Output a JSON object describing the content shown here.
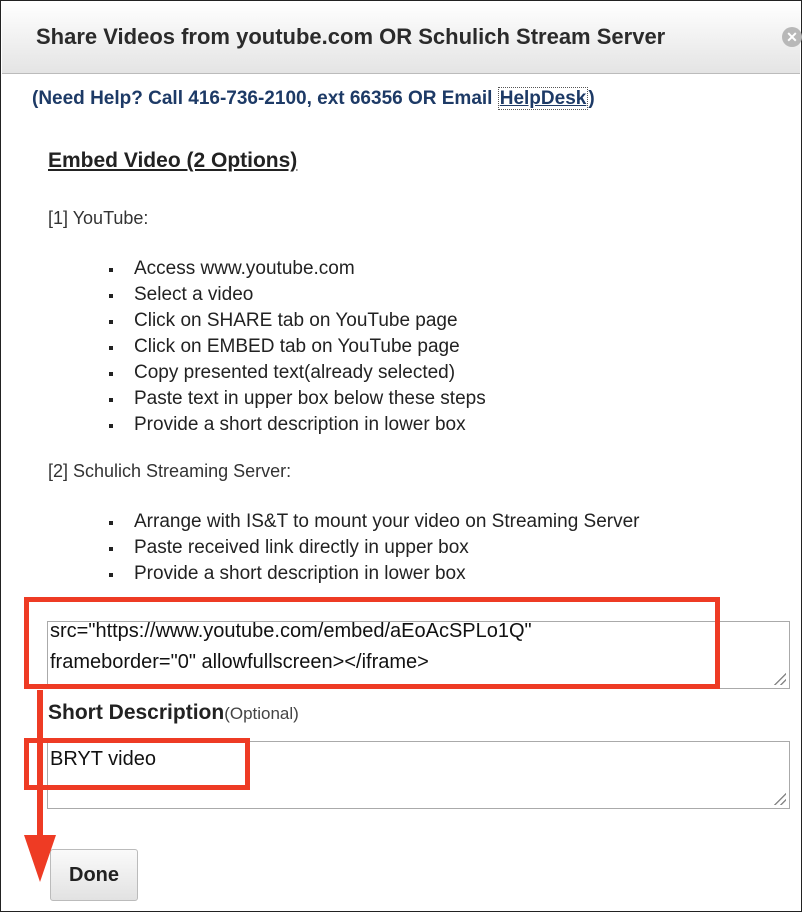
{
  "dialog": {
    "title": "Share Videos from youtube.com OR Schulich Stream Server",
    "close_icon": "close-icon"
  },
  "help": {
    "text": "(Need Help? Call 416-736-2100, ext 66356 OR Email ",
    "link": "HelpDesk",
    "end": ")"
  },
  "heading": "Embed Video (2 Options)",
  "option1": {
    "label": "[1] YouTube:",
    "steps": [
      "Access www.youtube.com",
      "Select a video",
      "Click on SHARE tab on YouTube page",
      "Click on EMBED tab on YouTube page",
      "Copy presented text(already selected)",
      "Paste text in upper box below these steps",
      "Provide a short description in lower box"
    ]
  },
  "option2": {
    "label": "[2] Schulich Streaming Server:",
    "steps": [
      "Arrange with IS&T to mount your video on Streaming Server",
      "Paste received link directly in upper box",
      "Provide a short description in lower box"
    ]
  },
  "embed_box": {
    "value": "src=\"https://www.youtube.com/embed/aEoAcSPLo1Q\"\nframeborder=\"0\" allowfullscreen></iframe>"
  },
  "short_description": {
    "label": "Short Description",
    "optional": "(Optional)",
    "value": "BRYT video"
  },
  "done_button": "Done",
  "colors": {
    "annotation": "#ee3b24",
    "help_text": "#1d3a66"
  }
}
